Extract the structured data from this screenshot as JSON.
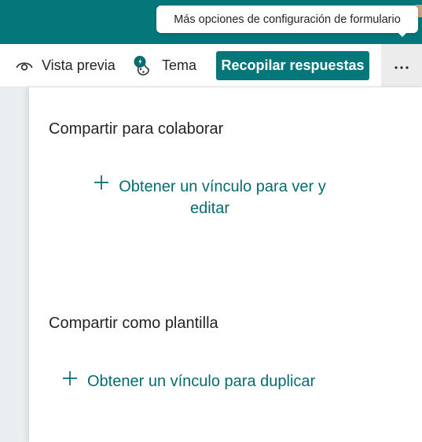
{
  "colors": {
    "brand": "#04777b",
    "link": "#056b6f",
    "text": "#252424",
    "page_bg": "#e9eff0",
    "more_button_bg": "#ececec"
  },
  "tooltip": {
    "text": "Más opciones de configuración de formulario"
  },
  "toolbar": {
    "preview_label": "Vista previa",
    "preview_icon": "eye-icon",
    "theme_label": "Tema",
    "theme_icon": "palette-icon",
    "collect_label": "Recopilar respuestas",
    "more_icon": "more-horizontal-icon"
  },
  "share_panel": {
    "collaborate": {
      "title": "Compartir para colaborar",
      "link_label": "Obtener un vínculo para ver y editar",
      "link_icon": "plus-icon"
    },
    "template": {
      "title": "Compartir como plantilla",
      "link_label": "Obtener un vínculo para duplicar",
      "link_icon": "plus-icon"
    }
  }
}
